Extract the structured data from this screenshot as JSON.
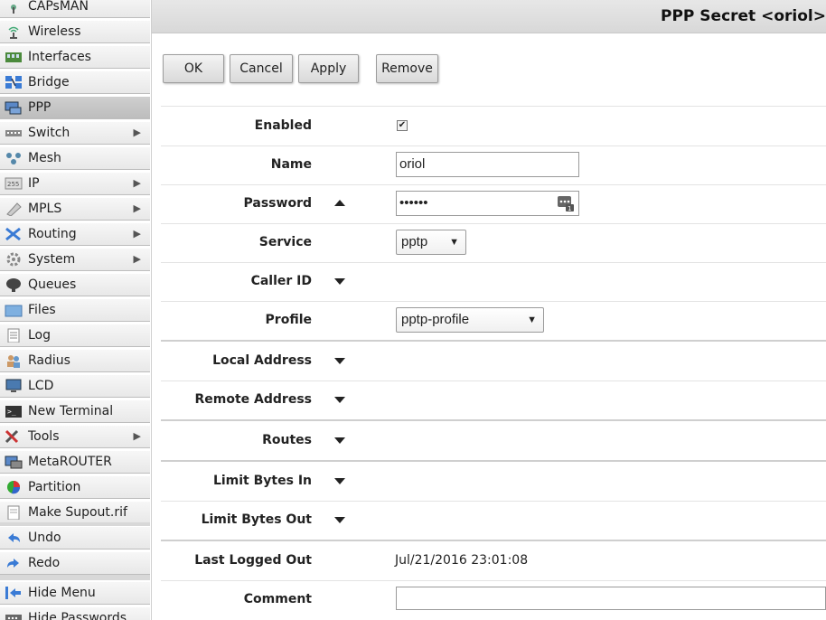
{
  "sidebar": {
    "items": [
      {
        "label": "CAPsMAN",
        "icon": "capsman-icon",
        "arrow": false
      },
      {
        "label": "Wireless",
        "icon": "wireless-icon",
        "arrow": false
      },
      {
        "label": "Interfaces",
        "icon": "interfaces-icon",
        "arrow": false
      },
      {
        "label": "Bridge",
        "icon": "bridge-icon",
        "arrow": false
      },
      {
        "label": "PPP",
        "icon": "ppp-icon",
        "arrow": false,
        "active": true
      },
      {
        "label": "Switch",
        "icon": "switch-icon",
        "arrow": true
      },
      {
        "label": "Mesh",
        "icon": "mesh-icon",
        "arrow": false
      },
      {
        "label": "IP",
        "icon": "ip-icon",
        "arrow": true
      },
      {
        "label": "MPLS",
        "icon": "mpls-icon",
        "arrow": true
      },
      {
        "label": "Routing",
        "icon": "routing-icon",
        "arrow": true
      },
      {
        "label": "System",
        "icon": "system-icon",
        "arrow": true
      },
      {
        "label": "Queues",
        "icon": "queues-icon",
        "arrow": false
      },
      {
        "label": "Files",
        "icon": "files-icon",
        "arrow": false
      },
      {
        "label": "Log",
        "icon": "log-icon",
        "arrow": false
      },
      {
        "label": "Radius",
        "icon": "radius-icon",
        "arrow": false
      },
      {
        "label": "LCD",
        "icon": "lcd-icon",
        "arrow": false
      },
      {
        "label": "New Terminal",
        "icon": "terminal-icon",
        "arrow": false
      },
      {
        "label": "Tools",
        "icon": "tools-icon",
        "arrow": true
      },
      {
        "label": "MetaROUTER",
        "icon": "metarouter-icon",
        "arrow": false
      },
      {
        "label": "Partition",
        "icon": "partition-icon",
        "arrow": false
      },
      {
        "label": "Make Supout.rif",
        "icon": "supout-icon",
        "arrow": false
      }
    ],
    "undo": "Undo",
    "redo": "Redo",
    "hide_menu": "Hide Menu",
    "hide_passwords": "Hide Passwords",
    "arrow_glyph": "▶"
  },
  "header": {
    "title": "PPP Secret <oriol>"
  },
  "toolbar": {
    "ok": "OK",
    "cancel": "Cancel",
    "apply": "Apply",
    "remove": "Remove"
  },
  "form": {
    "enabled_label": "Enabled",
    "enabled_checked": true,
    "name_label": "Name",
    "name_value": "oriol",
    "password_label": "Password",
    "password_value": "••••••",
    "service_label": "Service",
    "service_value": "pptp",
    "caller_id_label": "Caller ID",
    "profile_label": "Profile",
    "profile_value": "pptp-profile",
    "local_address_label": "Local Address",
    "remote_address_label": "Remote Address",
    "routes_label": "Routes",
    "limit_bytes_in_label": "Limit Bytes In",
    "limit_bytes_out_label": "Limit Bytes Out",
    "last_logged_out_label": "Last Logged Out",
    "last_logged_out_value": "Jul/21/2016 23:01:08",
    "comment_label": "Comment",
    "comment_value": "",
    "select_caret": "▼",
    "check_glyph": "✔"
  }
}
